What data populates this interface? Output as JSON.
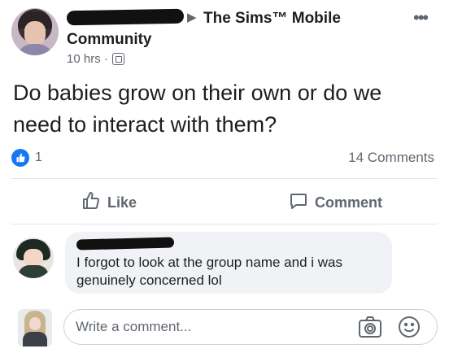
{
  "post": {
    "group_arrow": "▶",
    "group_name": "The Sims™ Mobile",
    "community_label": "Community",
    "time": "10 hrs ·",
    "more": "•••",
    "text": "Do babies grow on their own or do we need to interact with them?",
    "reaction_count": "1",
    "comments_count": "14 Comments"
  },
  "actions": {
    "like_label": "Like",
    "comment_label": "Comment"
  },
  "comment": {
    "text": "I forgot to look at the group name and i was genuinely concerned lol"
  },
  "composer": {
    "placeholder": "Write a comment..."
  },
  "colors": {
    "accent": "#1877f2",
    "secondary_text": "#606770",
    "bubble": "#f0f2f5"
  },
  "icons": [
    "globe-icon",
    "more-icon",
    "like-reaction-icon",
    "thumbs-up-icon",
    "comment-icon",
    "camera-icon",
    "emoji-icon"
  ]
}
